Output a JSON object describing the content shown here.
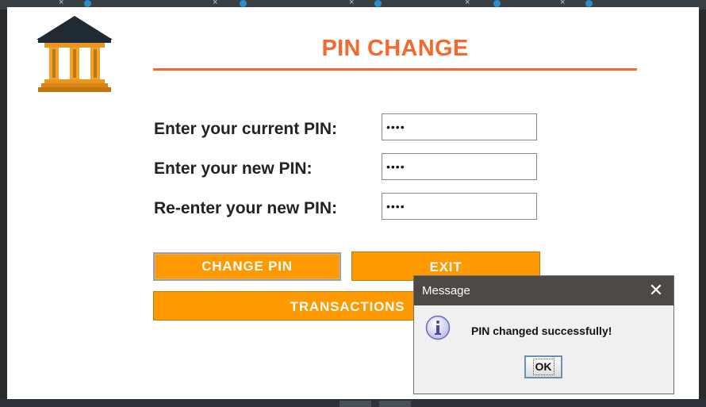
{
  "window": {
    "title": "PIN CHANGE"
  },
  "form": {
    "current_pin_label": "Enter your current PIN:",
    "new_pin_label": "Enter your new PIN:",
    "reenter_pin_label": "Re-enter your new PIN:",
    "current_pin_value": "••••",
    "new_pin_value": "••••",
    "reenter_pin_value": "••••"
  },
  "buttons": {
    "change_pin": "CHANGE PIN",
    "exit": "EXIT",
    "transactions": "TRANSACTIONS"
  },
  "dialog": {
    "title": "Message",
    "message": "PIN changed successfully!",
    "ok_label": "OK",
    "close_glyph": "✕",
    "icon": "info-icon"
  },
  "colors": {
    "accent": "#f26a2e",
    "button": "#fe9a00",
    "dialog_titlebar": "#4d4a45",
    "logo": "#e58a1f"
  }
}
